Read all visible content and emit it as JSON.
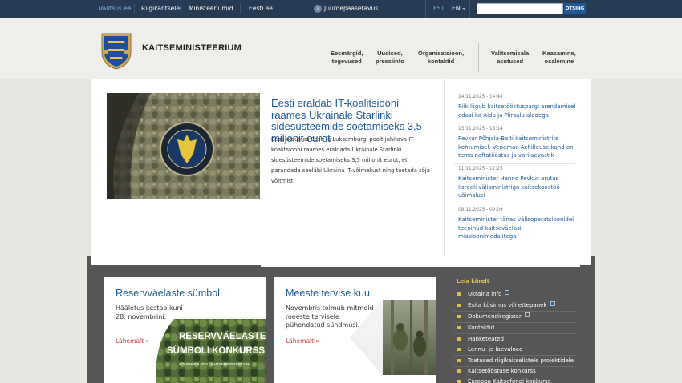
{
  "topbar": {
    "links": [
      "Valitsus.ee",
      "Riigikantselei",
      "Ministeeriumid",
      "Eesti.ee"
    ],
    "accessibility_label": "Juurdepääsetavus",
    "lang_active": "EST",
    "lang_other": "ENG",
    "search_placeholder": "",
    "search_button": "OTSING"
  },
  "header": {
    "brand": "Kaitseministeerium",
    "nav": [
      {
        "line1": "Eesmärgid,",
        "line2": "tegevused"
      },
      {
        "line1": "Uudised,",
        "line2": "pressiinfo"
      },
      {
        "line1": "Organisatsioon,",
        "line2": "kontaktid"
      },
      {
        "line1": "Valitsemisala",
        "line2": "asutused"
      },
      {
        "line1": "Kaasamine,",
        "line2": "osalemine"
      }
    ]
  },
  "lead": {
    "title": "Eesti eraldab IT-koalitsiooni raames Ukrainale Starlinki sidesüsteemide soetamiseks 3,5 miljonit eurot",
    "body": "Eesti otsustas Eesti ja Luksemburgi poolt juhitava IT-koalitsiooni raames eraldada Ukrainale Starlinki sidesüsteemide soetamiseks 3,5 miljonit eurot, et parandada seeläbi Ukraina IT-võimekust ning toetada sõja võitmist."
  },
  "news": [
    {
      "date": "14.11.2025 - 14:48",
      "title": "Riik liigub kaitsetööstuspargi arendamisel edasi ka Aidu ja Piirsalu aladega"
    },
    {
      "date": "13.11.2025 - 15:14",
      "title": "Pevkur Põhjala-Balti kaitseministrite kohtumisel: Venemaa Achilleuse kand on tema naftatööstus ja varilaevastik"
    },
    {
      "date": "11.11.2025 - 12:25",
      "title": "Kaitseminister Hanno Pevkur arutas Iisraeli välisministriga kaitsekoostöö võimalusi"
    },
    {
      "date": "08.11.2025 - 09:09",
      "title": "Kaitseminister tänas välisoperatsioonidel teeninud kaitseväelasi missioonimedalitega"
    }
  ],
  "cards": [
    {
      "title": "Reservväelaste sümbol",
      "text_line1": "Hääletus kestab kuni",
      "text_line2": "28. novembrini.",
      "more": "Lähemalt »",
      "banner_line1": "RESERVVÄELASTE",
      "banner_line2": "SÜMBOLI KONKURSS",
      "banner_line3": "NOVEMBER 2025 · KAITSEMINISTEERIUM"
    },
    {
      "title": "Meeste tervise kuu",
      "text_line1": "Novembris toimub mitmeid",
      "text_line2": "meeste tervisele",
      "text_line3": "pühendatud sündmusi.",
      "more": "Lähemalt »"
    }
  ],
  "links": {
    "title": "Leia kiirelt",
    "items": [
      {
        "label": "Ukraina info",
        "external": true
      },
      {
        "label": "Esita küsimus või ettepanek",
        "external": true
      },
      {
        "label": "Dokumendiregister",
        "external": true
      },
      {
        "label": "Kontaktid",
        "external": false
      },
      {
        "label": "Hanketeated",
        "external": false
      },
      {
        "label": "Lennu- ja laevaload",
        "external": false
      },
      {
        "label": "Toetused riigikaitselistele projektidele",
        "external": false
      },
      {
        "label": "Kaitsetööstuse konkurss",
        "external": false
      },
      {
        "label": "Euroopa Kaitsefondi konkurss",
        "external": false
      }
    ]
  },
  "colors": {
    "topbar": "#263c55",
    "accent_blue": "#1f5a97",
    "link_gold": "#e0bd4e",
    "more_red": "#cc3333"
  }
}
